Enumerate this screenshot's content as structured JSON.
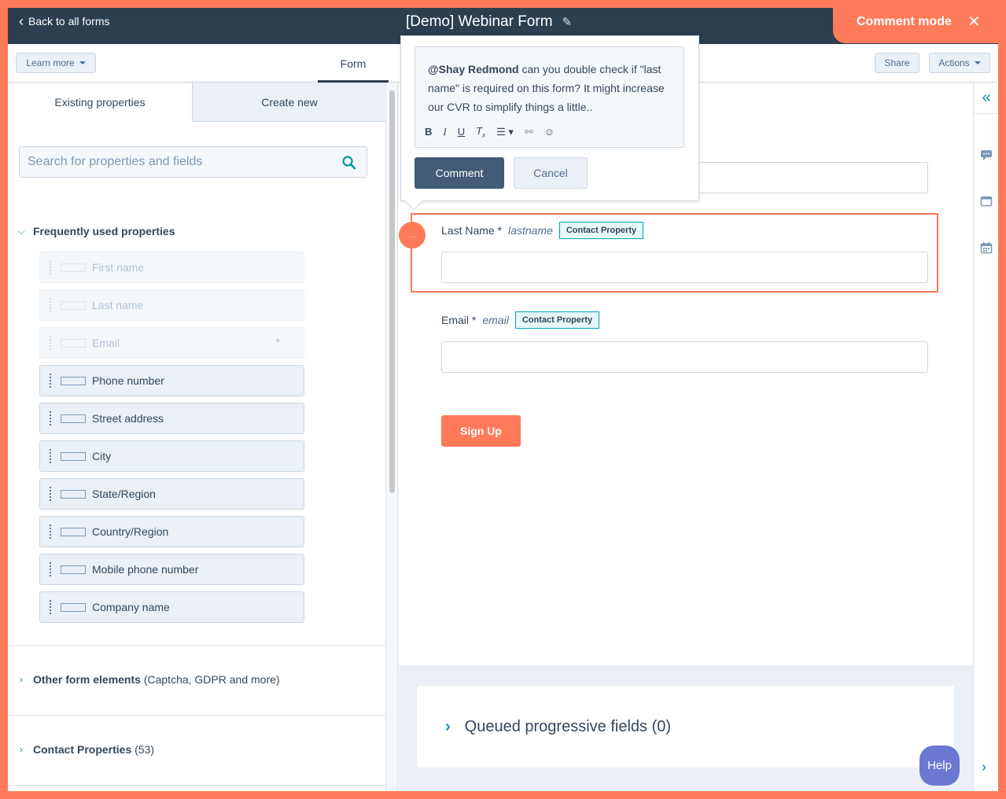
{
  "topbar": {
    "back_label": "Back to all forms",
    "form_title": "[Demo] Webinar Form",
    "comment_mode_label": "Comment mode"
  },
  "tabbar": {
    "learn_more": "Learn more",
    "form_tab": "Form",
    "share": "Share",
    "actions": "Actions"
  },
  "left_panel": {
    "tabs": [
      "Existing properties",
      "Create new"
    ],
    "search_placeholder": "Search for properties and fields",
    "frequently_used_title": "Frequently used properties",
    "properties": [
      {
        "label": "First name",
        "disabled": true
      },
      {
        "label": "Last name",
        "disabled": true
      },
      {
        "label": "Email",
        "disabled": true,
        "required_mark": "*"
      },
      {
        "label": "Phone number",
        "disabled": false
      },
      {
        "label": "Street address",
        "disabled": false
      },
      {
        "label": "City",
        "disabled": false
      },
      {
        "label": "State/Region",
        "disabled": false
      },
      {
        "label": "Country/Region",
        "disabled": false
      },
      {
        "label": "Mobile phone number",
        "disabled": false
      },
      {
        "label": "Company name",
        "disabled": false
      }
    ],
    "other_elements_title": "Other form elements",
    "other_elements_note": "(Captcha, GDPR and more)",
    "contact_properties_title": "Contact Properties",
    "contact_properties_count": "(53)"
  },
  "popover": {
    "mention": "@Shay Redmond",
    "message": " can you double check if \"last name\" is required on this form? It might increase our CVR to simplify things a little..",
    "toolbar": [
      "B",
      "I",
      "U",
      "Tx",
      "list",
      "link",
      "emoji"
    ],
    "comment_button": "Comment",
    "cancel_button": "Cancel"
  },
  "form": {
    "fields": [
      {
        "label": "Last Name *",
        "internal": "lastname",
        "badge": "Contact Property"
      },
      {
        "label": "Email *",
        "internal": "email",
        "badge": "Contact Property"
      }
    ],
    "submit_label": "Sign Up"
  },
  "progressive": {
    "label": "Queued progressive fields (0)"
  },
  "help_label": "Help",
  "colors": {
    "accent": "#ff7a59",
    "header": "#2d3e50",
    "teal": "#00a4bd",
    "help": "#6a78d1"
  }
}
